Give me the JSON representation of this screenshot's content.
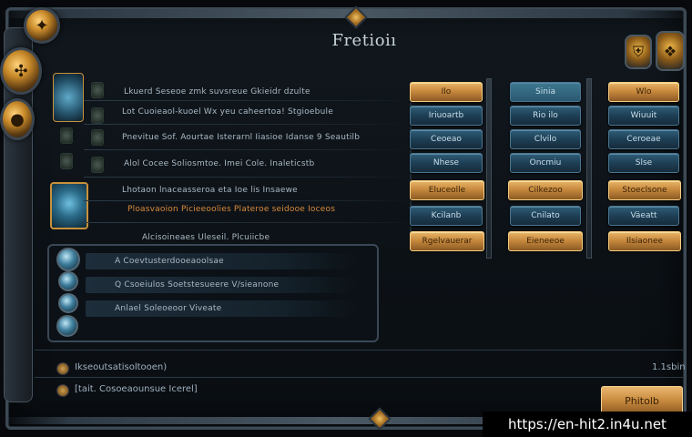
{
  "window": {
    "title": "Fretioiı",
    "watermark": "https://en-hit2.in4u.net"
  },
  "rows": [
    {
      "text": "Lkuerd Seseoe zmk suvsreue Gkieidr dzulte",
      "style": "normal"
    },
    {
      "text": "Lot Cuoieaol-kuoel Wx yeu caheertoa! Stgioebule",
      "style": "normal"
    },
    {
      "text": "Pnevitue Sof. Aourtae Isterarnl Iiasioe Idanse 9 Seautilb",
      "style": "normal"
    },
    {
      "text": "Alol Cocee Soliosmtoe. Imei Cole. Inaleticstb",
      "style": "normal"
    },
    {
      "text": "Lhotaon lnaceasseroa eta Ioe lis Insaewe",
      "style": "normal"
    },
    {
      "text": "Ploasvaoion Picieeoolies Plateroe seidooe Ioceos",
      "style": "orange"
    },
    {
      "text": "Alcisoineaes Uleseil. Plcuiicbe",
      "style": "normal"
    }
  ],
  "sub_rows": [
    {
      "text": "A Coevtusterdooeaoolsae"
    },
    {
      "text": "Q Csoeiulos Soetstesueere V/sieanone"
    },
    {
      "text": "Anlael Soleoeoor Viveate"
    }
  ],
  "buttons": {
    "col1": [
      "Ilo",
      "Iriuoartb",
      "Ceoeao",
      "Nhese",
      "Eluceolle",
      "Kcilanb",
      "Rgelvauerar"
    ],
    "col2": [
      "Sinia",
      "Rio ilo",
      "Clvilo",
      "Oncmiu",
      "Cilkezoo",
      "Cnilato",
      "Eieneeoe"
    ],
    "col3": [
      "Wlo",
      "Wiuuit",
      "Ceroeae",
      "Slse",
      "Stoeclsone",
      "Väeatt",
      "Ilsiaonee"
    ],
    "styles": [
      "gold",
      "blue",
      "blue",
      "blue",
      "gold",
      "blue",
      "gold"
    ]
  },
  "footer": {
    "line1": "Ikseoutsatisoltooen)",
    "line1_right": "1.1sbin",
    "line2": "[tait. Cosoeaounsue Icerel]",
    "confirm_label": "Phitolb"
  },
  "icons": {
    "top_left_medal": "gear-medallion",
    "left_medal_1": "ornate-cross-emblem",
    "left_medal_2": "ornate-orb-emblem",
    "top_right_1": "shield-badge",
    "top_right_2": "crest-badge"
  }
}
